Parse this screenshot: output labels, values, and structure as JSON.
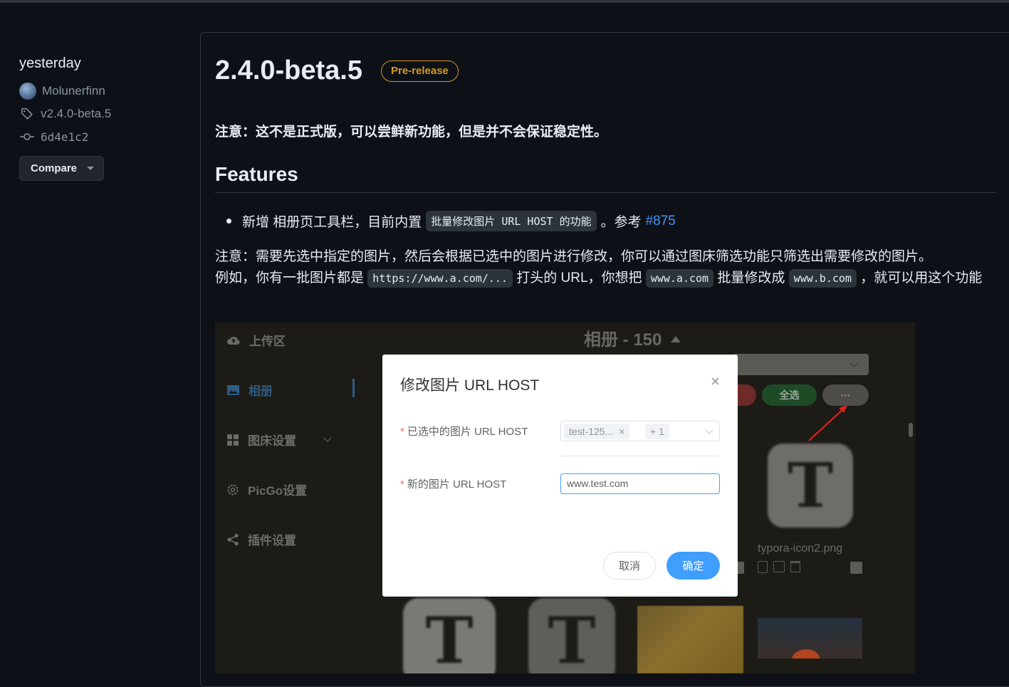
{
  "sidebar": {
    "when": "yesterday",
    "author": "Molunerfinn",
    "tag": "v2.4.0-beta.5",
    "commit": "6d4e1c2",
    "compare_label": "Compare"
  },
  "release": {
    "title": "2.4.0-beta.5",
    "badge": "Pre-release",
    "notice": "注意：这不是正式版，可以尝鲜新功能，但是并不会保证稳定性。",
    "features_heading": "Features",
    "bullet": {
      "prefix": "新增 相册页工具栏，目前内置",
      "code": "批量修改图片 URL HOST 的功能",
      "mid": "。参考",
      "link": "#875"
    },
    "para": {
      "line1": "注意：需要先选中指定的图片，然后会根据已选中的图片进行修改，你可以通过图床筛选功能只筛选出需要修改的图片。",
      "t1": "例如，你有一批图片都是",
      "c1": "https://www.a.com/...",
      "t2": "打头的 URL，你想把",
      "c2": "www.a.com",
      "t3": "批量修改成",
      "c3": "www.b.com",
      "t4": "，就可以用这个功能"
    }
  },
  "screenshot": {
    "nav": [
      "上传区",
      "相册",
      "图床设置",
      "PicGo设置",
      "插件设置"
    ],
    "album_title": "相册 - 150",
    "select_all": "全选",
    "more": "···",
    "filename": "typora-icon2.png",
    "modal": {
      "title": "修改图片 URL HOST",
      "close": "×",
      "label_selected": "已选中的图片 URL HOST",
      "tag1": "test-125...",
      "tag1_close": "×",
      "tag2": "+ 1",
      "label_new": "新的图片 URL HOST",
      "new_value": "www.test.com",
      "required_mark": "*",
      "cancel": "取消",
      "confirm": "确定"
    },
    "colors": {
      "primary": "#409eff",
      "danger": "#f56c6c",
      "prerelease": "#d29922",
      "link": "#4493f8"
    }
  }
}
